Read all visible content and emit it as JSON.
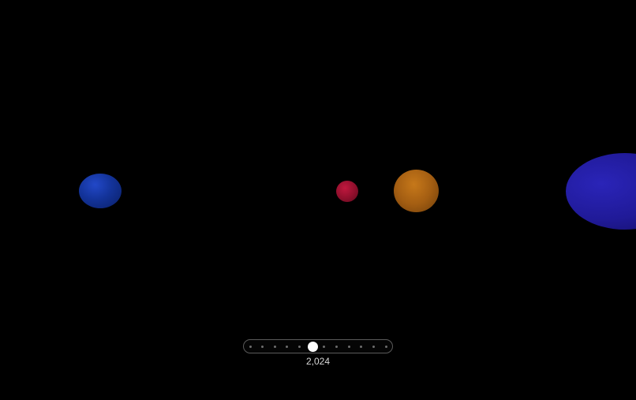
{
  "colors": {
    "background": "#000000",
    "sphere_blue": "#133399",
    "sphere_red": "#8f0f2c",
    "sphere_orange": "#a45e12",
    "sphere_indigo": "#201a98",
    "slider_thumb": "#ffffff",
    "slider_track_border": "#5a5a5a"
  },
  "slider": {
    "value_label": "2,024",
    "tick_count": 12,
    "position_fraction": 0.46
  }
}
